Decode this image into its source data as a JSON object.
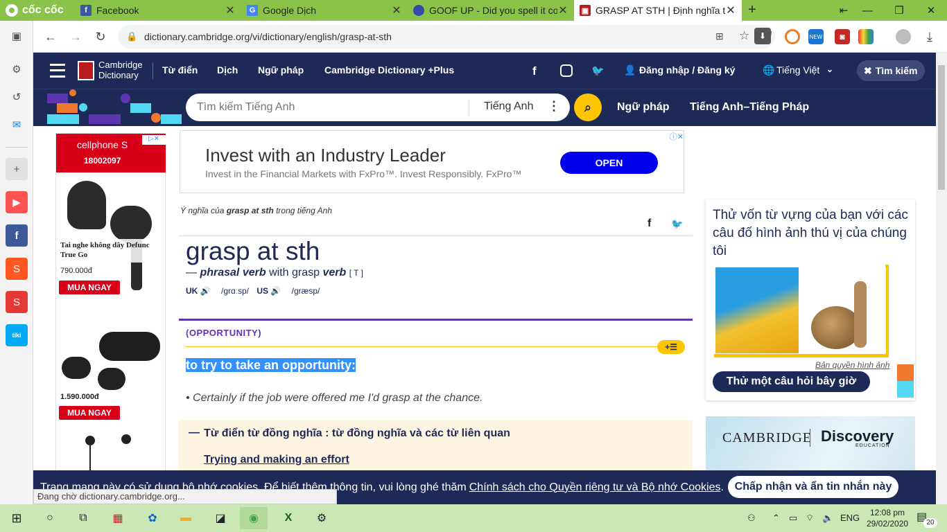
{
  "browser": {
    "brand": "cốc cốc",
    "tabs": [
      {
        "title": "Facebook",
        "icon": "facebook-icon"
      },
      {
        "title": "Google Dịch",
        "icon": "google-translate-icon"
      },
      {
        "title": "GOOF UP - Did you spell it co",
        "icon": "site-icon"
      },
      {
        "title": "GRASP AT STH | Định nghĩa tr",
        "icon": "cambridge-icon"
      }
    ],
    "new_tab": "+",
    "url": "dictionary.cambridge.org/vi/dictionary/english/grasp-at-sth",
    "status_text": "Đang chờ dictionary.cambridge.org..."
  },
  "site": {
    "logo_line1": "Cambridge",
    "logo_line2": "Dictionary",
    "nav": [
      "Từ điển",
      "Dịch",
      "Ngữ pháp",
      "Cambridge Dictionary +Plus"
    ],
    "login": "Đăng nhập / Đăng ký",
    "language": "Tiếng Việt",
    "search_toggle": "Tìm kiếm",
    "search_placeholder": "Tìm kiếm Tiếng Anh",
    "search_lang": "Tiếng Anh",
    "sub_nav": [
      "Ngữ pháp",
      "Tiếng Anh–Tiếng Pháp"
    ]
  },
  "ads": {
    "banner_title": "Invest with an Industry Leader",
    "banner_sub": "Invest in the Financial Markets with FxPro™. Invest Responsibly. FxPro™",
    "banner_button": "OPEN",
    "left_brand": "cellphone S",
    "left_phone": "18002097",
    "products": [
      {
        "name": "Tai nghe không dây Defunc True Go",
        "price": "790.000đ",
        "button": "MUA NGAY"
      },
      {
        "name": "",
        "price": "1.590.000đ",
        "button": "MUA NGAY"
      }
    ],
    "right_logo1": "CAMBRIDGE",
    "right_logo2": "Discovery",
    "right_logo3": "EDUCATION"
  },
  "entry": {
    "breadcrumb_pre": "Ý nghĩa của ",
    "breadcrumb_word": "grasp at sth",
    "breadcrumb_post": " trong tiếng Anh",
    "headword": "grasp at sth",
    "pos_dash": "—",
    "pos": "phrasal verb",
    "with_text": "with grasp",
    "verb": "verb",
    "grammar": "[ T ]",
    "uk_label": "UK",
    "uk_ipa": "/ɡrɑːsp/",
    "us_label": "US",
    "us_ipa": "/ɡræsp/",
    "guideword": "(OPPORTUNITY)",
    "definition": "to try to take an opportunity:",
    "example": "Certainly if the job were offered me I'd grasp at the chance.",
    "thes_title": "Từ điển từ đồng nghĩa : từ đồng nghĩa và các từ liên quan",
    "thes_link": "Trying and making an effort"
  },
  "quiz": {
    "title": "Thử vốn từ vựng của bạn với các câu đố hình ảnh thú vị của chúng tôi",
    "copyright": "Bản quyền hình ảnh",
    "button": "Thử một câu hỏi bây giờ"
  },
  "cookie": {
    "text": "Trang mạng này có sử dụng bộ nhớ cookies. Để biết thêm thông tin, vui lòng ghé thăm ",
    "link": "Chính sách cho Quyền riêng tư và Bộ nhớ Cookies",
    "end": ".",
    "button": "Chấp nhận và ẩn tin nhắn này"
  },
  "taskbar": {
    "lang": "ENG",
    "time": "12:08 pm",
    "date": "29/02/2020",
    "notif_count": "20"
  },
  "colors": {
    "nav": "#1d2a57",
    "accent": "#fec400",
    "browser": "#8bc34a",
    "sense": "#5e35b1"
  }
}
